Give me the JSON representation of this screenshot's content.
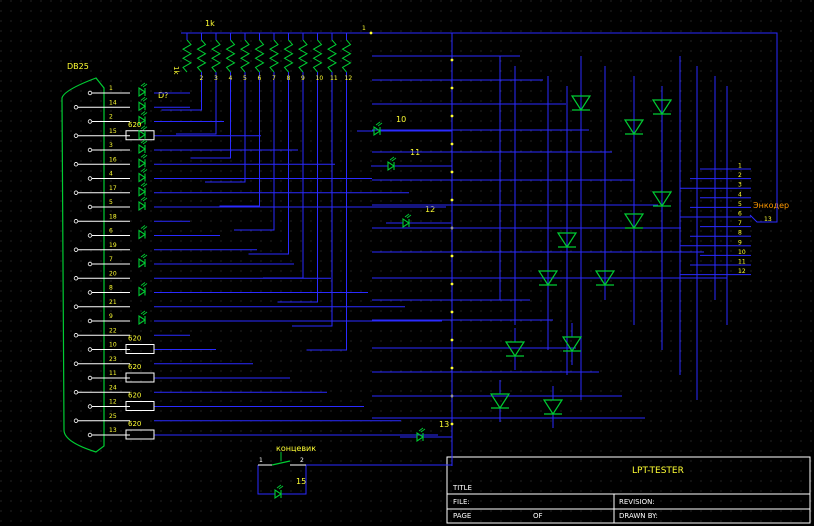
{
  "connector": {
    "name": "DB25"
  },
  "resistor_array": {
    "value": "1k",
    "label_vertical": "1k"
  },
  "top_marker": "1",
  "array_pins": [
    "2",
    "3",
    "4",
    "5",
    "6",
    "7",
    "8",
    "9",
    "10",
    "11",
    "12"
  ],
  "db25_pins": [
    {
      "n": "1"
    },
    {
      "n": "14"
    },
    {
      "n": "2"
    },
    {
      "n": "15"
    },
    {
      "n": "3"
    },
    {
      "n": "16"
    },
    {
      "n": "4"
    },
    {
      "n": "17"
    },
    {
      "n": "5"
    },
    {
      "n": "18"
    },
    {
      "n": "6"
    },
    {
      "n": "19"
    },
    {
      "n": "7"
    },
    {
      "n": "20"
    },
    {
      "n": "8"
    },
    {
      "n": "21"
    },
    {
      "n": "9"
    },
    {
      "n": "22"
    },
    {
      "n": "10"
    },
    {
      "n": "23"
    },
    {
      "n": "11"
    },
    {
      "n": "24"
    },
    {
      "n": "12"
    },
    {
      "n": "25"
    },
    {
      "n": "13"
    }
  ],
  "labels": {
    "d_top": "D?",
    "r620": "620",
    "led10": "10",
    "led11": "11",
    "led12": "12",
    "led13": "13",
    "led15": "15",
    "switch": "концевик",
    "sw_pin1": "1",
    "sw_pin2": "2",
    "encoder": "Энкодер",
    "encoder_pin13": "13"
  },
  "encoder_pins": [
    "1",
    "2",
    "3",
    "4",
    "5",
    "6",
    "7",
    "8",
    "9",
    "10",
    "11",
    "12"
  ],
  "title_block": {
    "project": "LPT-TESTER",
    "title": "TITLE",
    "file": "FILE:",
    "revision": "REVISION:",
    "page": "PAGE",
    "of": "OF",
    "drawn_by": "DRAWN BY:"
  },
  "colors": {
    "grid": "#3a3a3a",
    "wire": "#2a2aff",
    "component": "#00cc33",
    "label": "#ffff33",
    "white": "#ffffff",
    "accent": "#ff9900"
  }
}
